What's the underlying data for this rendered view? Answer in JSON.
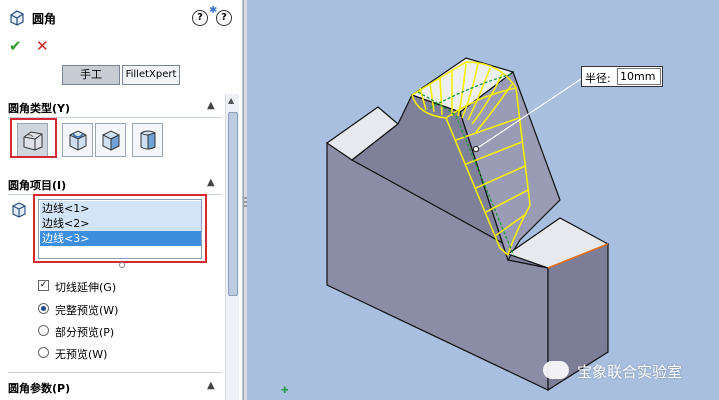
{
  "panel": {
    "title": "圆角",
    "help_label": "?",
    "whatsnew_label": "?",
    "ok_symbol": "✔",
    "cancel_symbol": "✕",
    "tabs": [
      {
        "label": "手工",
        "selected": true
      },
      {
        "label": "FilletXpert",
        "selected": false
      }
    ],
    "fillet_type": {
      "title": "圆角类型(Y)",
      "options": [
        {
          "icon": "constant-radius-fillet-icon",
          "selected": true
        },
        {
          "icon": "variable-radius-fillet-icon",
          "selected": false
        },
        {
          "icon": "face-fillet-icon",
          "selected": false
        },
        {
          "icon": "full-round-fillet-icon",
          "selected": false
        }
      ]
    },
    "fillet_items": {
      "title": "圆角项目(I)",
      "list": [
        "边线<1>",
        "边线<2>",
        "边线<3>"
      ],
      "selected_index": 2
    },
    "options": {
      "tangent_propagation": {
        "label": "切线延伸(G)",
        "checked": true
      },
      "preview": [
        {
          "label": "完整预览(W)",
          "checked": true
        },
        {
          "label": "部分预览(P)",
          "checked": false
        },
        {
          "label": "无预览(W)",
          "checked": false
        }
      ]
    },
    "fillet_params": {
      "title": "圆角参数(P)"
    }
  },
  "viewport": {
    "dimension": {
      "label": "半径:",
      "value": "10mm"
    },
    "watermark": "宝象联合实验室"
  },
  "colors": {
    "viewport_bg": "#a9bfdf",
    "model_face": "#8f90ab",
    "model_top": "#ececf0",
    "fillet_outline": "#f3f000",
    "edge_green": "#1f9a3a",
    "highlight_blue": "#3e8ede",
    "annotation_red": "#d42a33"
  }
}
